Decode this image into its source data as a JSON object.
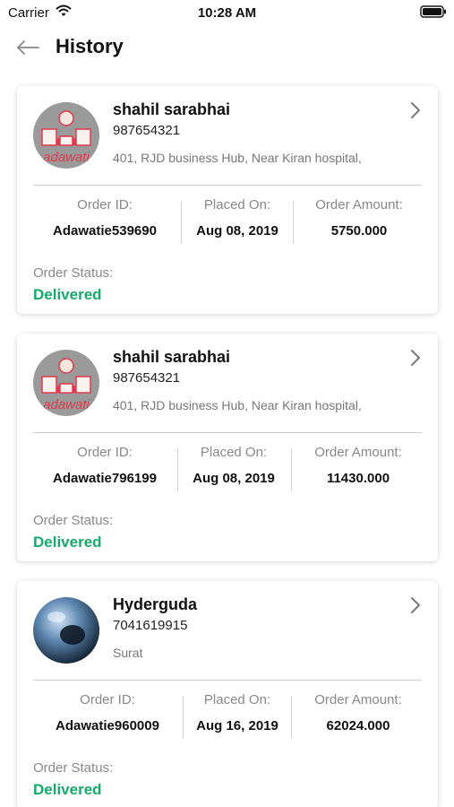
{
  "status_bar": {
    "carrier": "Carrier",
    "time": "10:28 AM"
  },
  "header": {
    "title": "History",
    "back_icon": "arrow-left-icon"
  },
  "labels": {
    "order_id": "Order ID:",
    "placed_on": "Placed On:",
    "order_amount": "Order Amount:",
    "order_status": "Order Status:"
  },
  "orders": [
    {
      "customer": "shahil sarabhai",
      "phone": "987654321",
      "address": "401, RJD business Hub, Near Kiran hospital,",
      "avatar_text": "adawati",
      "order_id": "Adawatie539690",
      "placed_on": "Aug 08, 2019",
      "amount": "5750.000",
      "status": "Delivered"
    },
    {
      "customer": "shahil sarabhai",
      "phone": "987654321",
      "address": "401, RJD business Hub, Near Kiran hospital,",
      "avatar_text": "adawati",
      "order_id": "Adawatie796199",
      "placed_on": "Aug 08, 2019",
      "amount": "11430.000",
      "status": "Delivered"
    },
    {
      "customer": "Hyderguda",
      "phone": "7041619915",
      "address": "Surat",
      "order_id": "Adawatie960009",
      "placed_on": "Aug 16, 2019",
      "amount": "62024.000",
      "status": "Delivered"
    }
  ],
  "colors": {
    "delivered": "#1aa86a",
    "brand": "#e03a4e"
  }
}
